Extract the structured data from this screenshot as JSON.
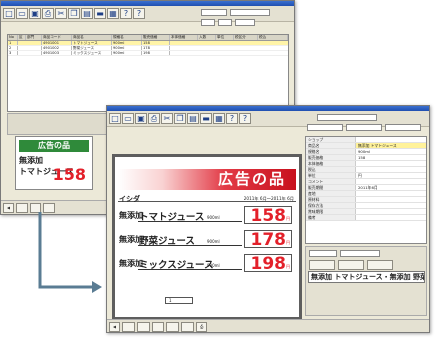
{
  "back_window": {
    "toolbar_icons": [
      "new-icon",
      "open-icon",
      "save-icon",
      "print-icon",
      "cut-icon",
      "copy-icon",
      "paste-icon",
      "car-icon",
      "grid-icon",
      "help-icon",
      "question-icon"
    ],
    "grid": {
      "columns": [
        "No",
        "区",
        "部門",
        "商品コード",
        "商品名",
        "規格名",
        "販売価格",
        "本体価格",
        "入数",
        "単位",
        "税区分",
        "税込"
      ],
      "rows": [
        {
          "no": "1",
          "code": "4901001",
          "name": "トマトジュース",
          "std": "900ml",
          "price": "158",
          "selected": true
        },
        {
          "no": "2",
          "code": "4901002",
          "name": "野菜ジュース",
          "std": "900ml",
          "price": "178",
          "selected": false
        },
        {
          "no": "3",
          "code": "4901003",
          "name": "ミックスジュース",
          "std": "900ml",
          "price": "198",
          "selected": false
        }
      ]
    },
    "mini_pop": {
      "header": "広告の品",
      "tag": "無添加",
      "name": "トマトジュース",
      "price": "158"
    }
  },
  "front_window": {
    "banner": "広告の品",
    "store": "イシダ",
    "dates": "2011年 6月〜2011年 6月",
    "items": [
      {
        "tag": "無添加",
        "name": "トマトジュース",
        "volume": "900ml",
        "price": "158",
        "yen": "円"
      },
      {
        "tag": "無添加",
        "name": "野菜ジュース",
        "volume": "900ml",
        "price": "178",
        "yen": "円"
      },
      {
        "tag": "無添加",
        "name": "ミックスジュース",
        "volume": "900ml",
        "price": "198",
        "yen": "円"
      }
    ],
    "pager": "1",
    "properties": [
      {
        "key": "ショップ",
        "value": "",
        "hl": false
      },
      {
        "key": "商品名",
        "value": "無添加 トマトジュース",
        "hl": true
      },
      {
        "key": "規格名",
        "value": "900ml",
        "hl": false
      },
      {
        "key": "販売価格",
        "value": "158",
        "hl": false
      },
      {
        "key": "本体価格",
        "value": "",
        "hl": false
      },
      {
        "key": "税込",
        "value": "",
        "hl": false
      },
      {
        "key": "単位",
        "value": "円",
        "hl": false
      },
      {
        "key": "コメント",
        "value": "",
        "hl": false
      },
      {
        "key": "販売期間",
        "value": "2011年6月",
        "hl": false
      },
      {
        "key": "産地",
        "value": "",
        "hl": false
      },
      {
        "key": "原材料",
        "value": "",
        "hl": false
      },
      {
        "key": "保存方法",
        "value": "",
        "hl": false
      },
      {
        "key": "賞味期限",
        "value": "",
        "hl": false
      },
      {
        "key": "備考",
        "value": "",
        "hl": false
      }
    ],
    "text_entry": "無添加 トマトジュース・無添加 野菜"
  }
}
